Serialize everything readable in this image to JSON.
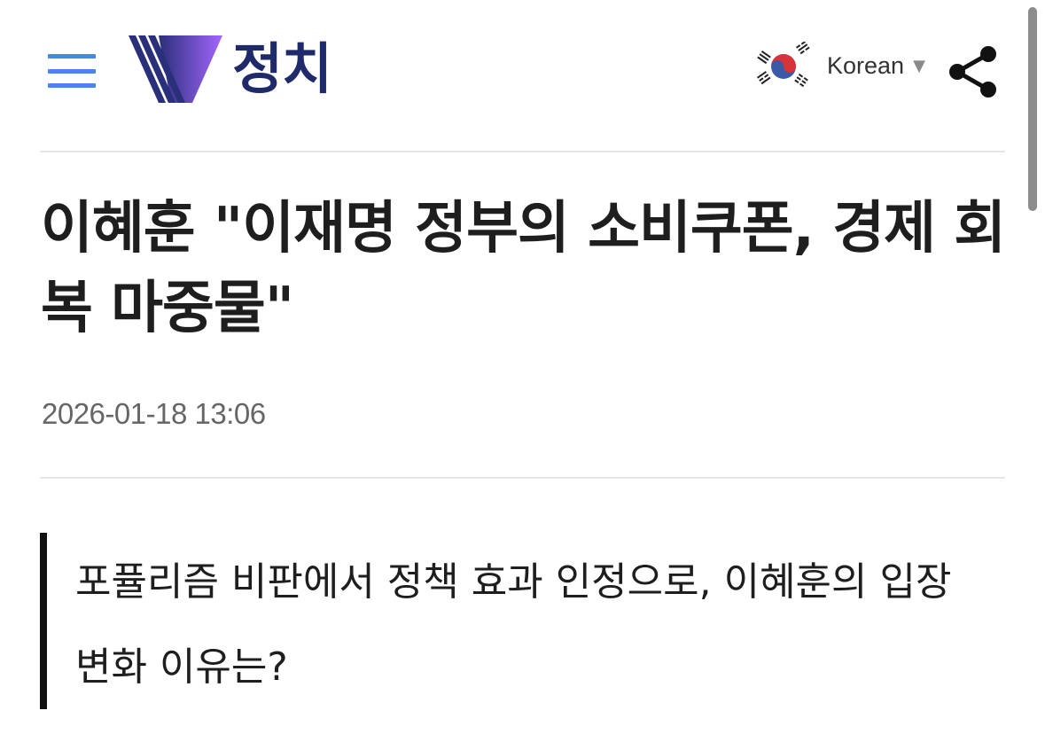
{
  "header": {
    "section_title": "정치",
    "language": {
      "label": "Korean",
      "caret": "▼"
    },
    "menu_icon": "hamburger-menu-icon",
    "flag_icon": "korea-flag-icon",
    "share_icon": "share-icon"
  },
  "article": {
    "headline": "이혜훈 \"이재명 정부의 소비쿠폰, 경제 회복 마중물\"",
    "date": "2026-01-18 13:06",
    "summary": "포퓰리즘 비판에서 정책 효과 인정으로, 이혜훈의 입장 변화 이유는?"
  },
  "colors": {
    "menu_accent": "#4a86e8",
    "section_title": "#1f2a6b",
    "logo_gradient_start": "#2a2f7a",
    "logo_gradient_end": "#9b5cf0"
  }
}
